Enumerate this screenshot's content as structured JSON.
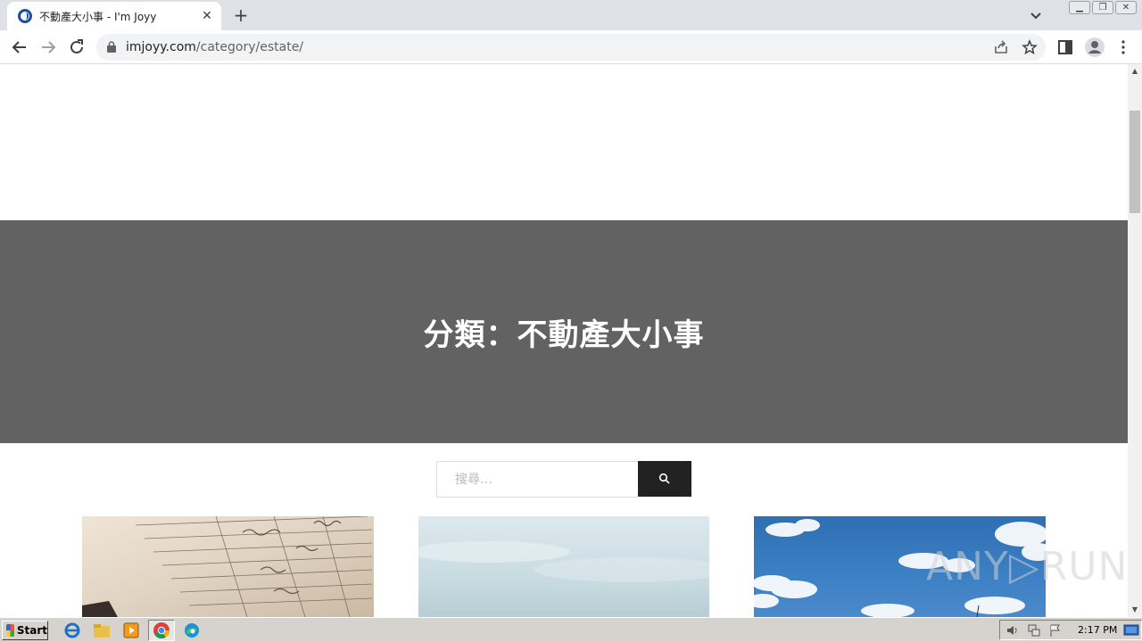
{
  "browser": {
    "tab_title": "不動產大小事 - I'm Joyy",
    "new_tab": "+",
    "close_tab": "✕",
    "url_domain": "imjoyy.com",
    "url_path": "/category/estate/"
  },
  "page": {
    "category_title": "分類：不動產大小事",
    "search_placeholder": "搜尋…"
  },
  "watermark": "ANY▷RUN",
  "taskbar": {
    "start_label": "Start",
    "clock": "2:17 PM"
  },
  "colors": {
    "hero_bg": "#626262",
    "search_button_bg": "#222222",
    "tab_strip_bg": "#dee1e6"
  }
}
